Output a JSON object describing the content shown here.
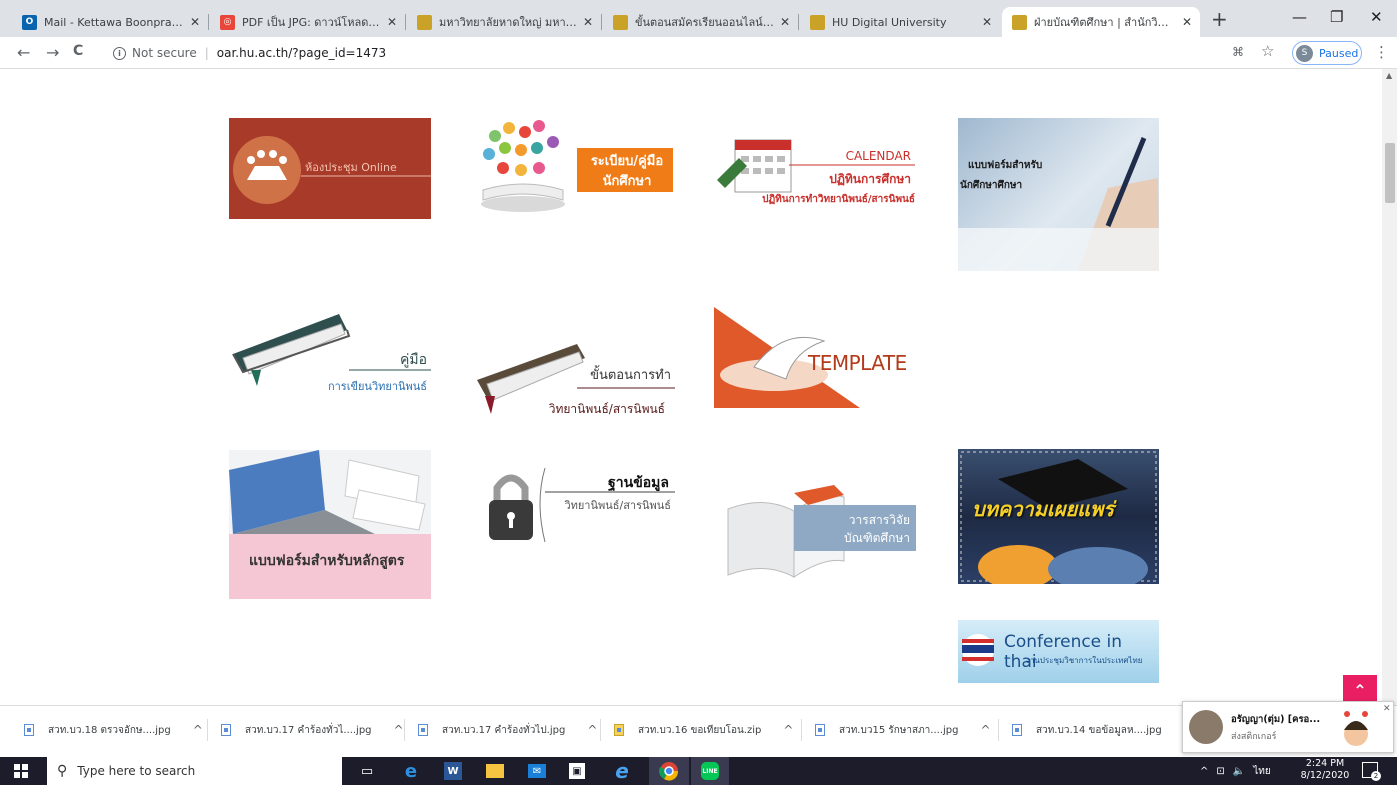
{
  "browser": {
    "tabs": [
      {
        "title": "Mail - Kettawa Boonprakarn - (",
        "favicon_color": "#0a64ad",
        "favicon_glyph": "O",
        "active": false
      },
      {
        "title": "PDF เป็น JPG: ดาวน์โหลดไฟล์",
        "favicon_color": "#e8463a",
        "favicon_glyph": "◎",
        "active": false
      },
      {
        "title": "มหาวิทยาลัยหาดใหญ่ มหาวิทยาลัยเอ",
        "favicon_color": "#c9a227",
        "favicon_glyph": "",
        "active": false
      },
      {
        "title": "ขั้นตอนสมัครเรียนออนไลน์ ระดับปริ",
        "favicon_color": "#c9a227",
        "favicon_glyph": "",
        "active": false
      },
      {
        "title": "HU Digital University",
        "favicon_color": "#c9a227",
        "favicon_glyph": "",
        "active": false
      },
      {
        "title": "ฝ่ายบัณฑิตศึกษา | สำนักวิชาการแล",
        "favicon_color": "#c9a227",
        "favicon_glyph": "",
        "active": true
      }
    ],
    "close_glyph": "✕",
    "new_tab_glyph": "+",
    "window_controls": {
      "minimize": "—",
      "restore": "❐",
      "close": "✕"
    },
    "nav": {
      "back": "←",
      "forward": "→",
      "reload": "C"
    },
    "address": {
      "security_label": "Not secure",
      "url": "oar.hu.ac.th/?page_id=1473",
      "info_glyph": "i",
      "divider": "|"
    },
    "toolbar_icons": {
      "translate": "⌘",
      "star": "☆",
      "menu": "⋮"
    },
    "profile": {
      "initial": "S",
      "status": "Paused"
    }
  },
  "page": {
    "tiles": [
      {
        "id": "meeting-online",
        "text": "ห้องประชุม Online",
        "bg": "#a83a2a"
      },
      {
        "id": "student-rules",
        "text_line1": "ระเบียบ/คู่มือ",
        "text_line2": "นักศึกษา",
        "accent": "#f07c17"
      },
      {
        "id": "calendar",
        "text_line1": "CALENDAR",
        "text_line2": "ปฏิทินการศึกษา",
        "text_line3": "ปฏิทินการทำวิทยานิพนธ์/สารนิพนธ์",
        "accent": "#c9302c"
      },
      {
        "id": "graduate-forms",
        "text_line1": "แบบฟอร์มสำหรับ",
        "text_line2": "นักศึกษาศึกษา"
      },
      {
        "id": "thesis-handbook",
        "text_line1": "คู่มือ",
        "text_line2": "การเขียนวิทยานิพนธ์",
        "accent": "#2f4f4f"
      },
      {
        "id": "thesis-steps",
        "text_line1": "ขั้นตอนการทำ",
        "text_line2": "วิทยานิพนธ์/สารนิพนธ์",
        "accent": "#5a1a1a"
      },
      {
        "id": "template",
        "text": "TEMPLATE",
        "accent": "#e0592a"
      },
      {
        "id": "curriculum-forms",
        "text": "แบบฟอร์มสำหรับหลักสูตร",
        "accent": "#f5c7d4"
      },
      {
        "id": "thesis-database",
        "text_line1": "ฐานข้อมูล",
        "text_line2": "วิทยานิพนธ์/สารนิพนธ์"
      },
      {
        "id": "graduate-journal",
        "text_line1": "วารสารวิจัย",
        "text_line2": "บัณฑิตศึกษา",
        "accent": "#8fa9c4"
      },
      {
        "id": "published-articles",
        "text": "บทความเผยแพร่",
        "accent": "#f5d027"
      },
      {
        "id": "conference-thai",
        "text_line1": "Conference in thai",
        "text_line2": "งานประชุมวิชาการในประเทศไทย",
        "accent": "#4aa3d8"
      }
    ],
    "back_to_top_glyph": "⌃"
  },
  "downloads": {
    "items": [
      {
        "name": "สวท.บว.18 ตรวจอักษ....jpg",
        "kind": "jpg"
      },
      {
        "name": "สวท.บว.17 คำร้องทั่วไ....jpg",
        "kind": "jpg"
      },
      {
        "name": "สวท.บว.17 คำร้องทั่วไป.jpg",
        "kind": "jpg"
      },
      {
        "name": "สวท.บว.16 ขอเทียบโอน.zip",
        "kind": "zip"
      },
      {
        "name": "สวท.บว15 รักษาสภา....jpg",
        "kind": "jpg"
      },
      {
        "name": "สวท.บว.14 ขอข้อมูลห....jpg",
        "kind": "jpg"
      }
    ],
    "chevron_glyph": "^"
  },
  "notification": {
    "sender": "อรัญญา(ตุ่ม) [ครอ...",
    "message": "ส่งสติกเกอร์",
    "close_glyph": "✕"
  },
  "taskbar": {
    "search_placeholder": "Type here to search",
    "search_glyph": "⚲",
    "tray": {
      "chevron": "^",
      "network": "⊡",
      "volume": "🔈",
      "ime": "ไทย"
    },
    "time": "2:24 PM",
    "date": "8/12/2020",
    "notification_count": "2"
  }
}
